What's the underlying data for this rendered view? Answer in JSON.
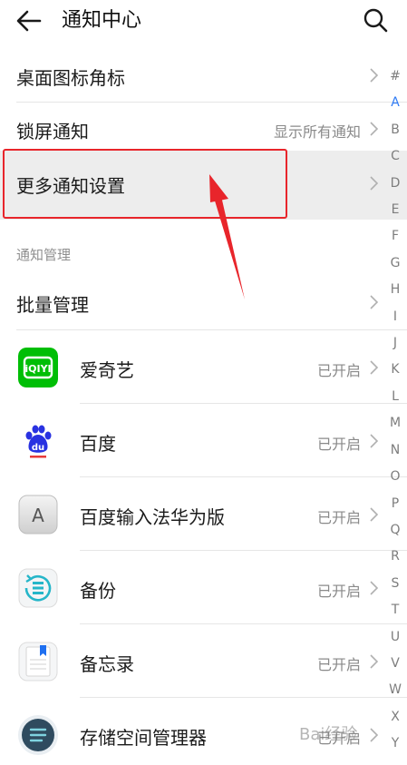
{
  "header": {
    "title": "通知中心"
  },
  "settings": [
    {
      "label": "桌面图标角标",
      "value": ""
    },
    {
      "label": "锁屏通知",
      "value": "显示所有通知"
    },
    {
      "label": "更多通知设置",
      "value": ""
    }
  ],
  "section": {
    "title": "通知管理"
  },
  "batch": {
    "label": "批量管理"
  },
  "apps": [
    {
      "name": "爱奇艺",
      "status": "已开启",
      "icon": "iqiyi-icon"
    },
    {
      "name": "百度",
      "status": "已开启",
      "icon": "baidu-icon"
    },
    {
      "name": "百度输入法华为版",
      "status": "已开启",
      "icon": "baidu-input-icon"
    },
    {
      "name": "备份",
      "status": "已开启",
      "icon": "backup-icon"
    },
    {
      "name": "备忘录",
      "status": "已开启",
      "icon": "memo-icon"
    },
    {
      "name": "存储空间管理器",
      "status": "已开启",
      "icon": "storage-manager-icon"
    }
  ],
  "index": [
    "#",
    "A",
    "B",
    "C",
    "D",
    "E",
    "F",
    "G",
    "H",
    "I",
    "J",
    "K",
    "L",
    "M",
    "N",
    "O",
    "P",
    "Q",
    "R",
    "S",
    "T",
    "U",
    "V",
    "W",
    "X",
    "Y"
  ],
  "index_active": "A",
  "colors": {
    "accent": "#2f7bf5",
    "highlight": "#e8252b",
    "iqiyi_green": "#00be06",
    "baidu_blue": "#2932e1"
  },
  "watermark": "Bai经验"
}
